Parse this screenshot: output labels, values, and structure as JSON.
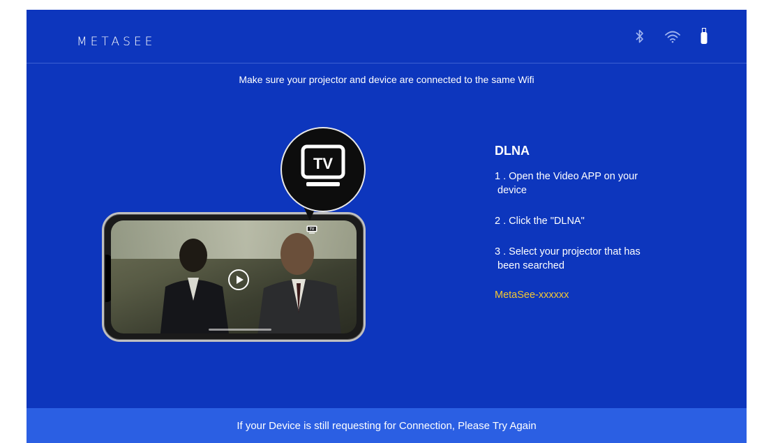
{
  "header": {
    "logo_text": "METASEE",
    "icons": [
      "bluetooth-icon",
      "wifi-icon",
      "usb-icon"
    ]
  },
  "instruction": "Make sure your projector and device are connected to the same Wifi",
  "illustration": {
    "tv_label": "TV"
  },
  "guide": {
    "title": "DLNA",
    "steps": [
      {
        "line1": "1 . Open the Video APP on your",
        "line2": "device"
      },
      {
        "line1": "2 . Click the  \"DLNA\"",
        "line2": ""
      },
      {
        "line1": "3 . Select your projector that has",
        "line2": "been searched"
      }
    ],
    "device_name": "MetaSee-xxxxxx"
  },
  "footer_text": "If your Device is still requesting for Connection, Please Try Again",
  "colors": {
    "background": "#0d36bd",
    "footer": "#2b5fe3",
    "device_name": "#f5c830"
  }
}
